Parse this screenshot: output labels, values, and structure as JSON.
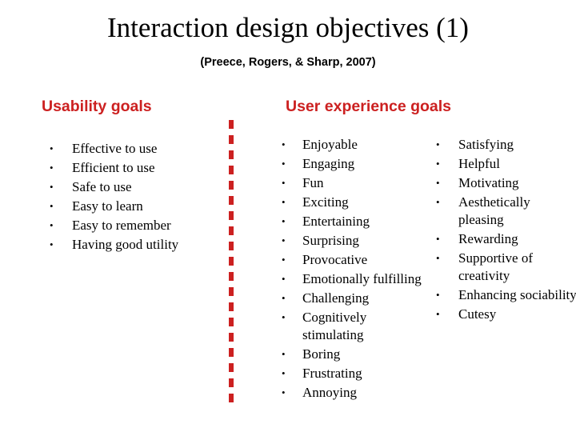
{
  "slide": {
    "title": "Interaction design objectives (1)",
    "subtitle": "(Preece, Rogers, & Sharp, 2007)",
    "accent_color": "#cc2020",
    "text_color": "#000000",
    "background_color": "#ffffff",
    "bullet_glyph": "•"
  },
  "sections": {
    "usability": {
      "heading": "Usability goals",
      "items": [
        "Effective to use",
        "Efficient to use",
        "Safe to use",
        "Easy to learn",
        "Easy to remember",
        "Having good utility"
      ]
    },
    "user_experience": {
      "heading": "User experience goals",
      "column_a": [
        "Enjoyable",
        "Engaging",
        "Fun",
        "Exciting",
        "Entertaining",
        "Surprising",
        "Provocative",
        "Emotionally fulfilling",
        "Challenging",
        "Cognitively stimulating",
        "Boring",
        "Frustrating",
        "Annoying"
      ],
      "column_b": [
        "Satisfying",
        "Helpful",
        "Motivating",
        "Aesthetically pleasing",
        "Rewarding",
        "Supportive of creativity",
        "Enhancing sociability",
        "Cutesy"
      ]
    }
  }
}
